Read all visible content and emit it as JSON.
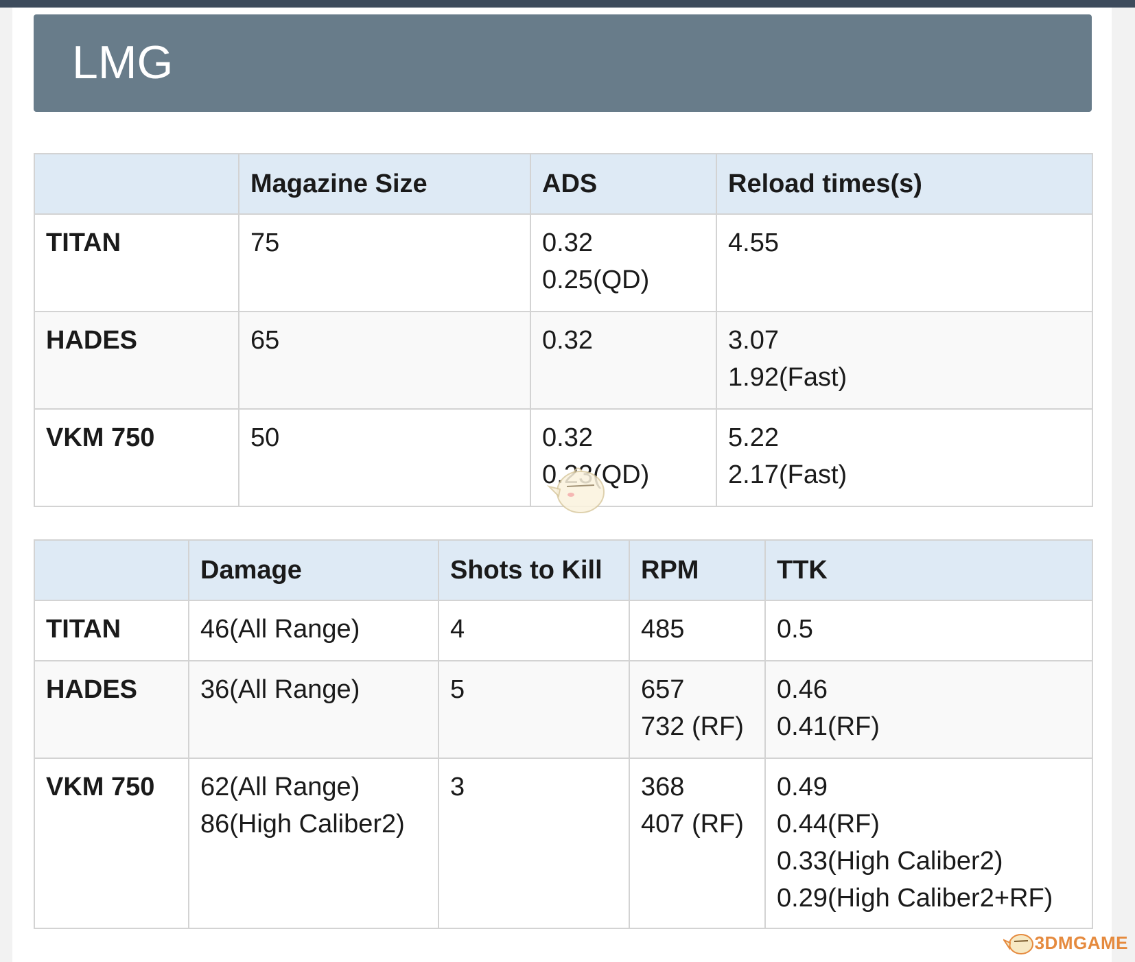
{
  "section_title": "LMG",
  "table_handling": {
    "headers": [
      "",
      "Magazine Size",
      "ADS",
      "Reload times(s)"
    ],
    "rows": [
      {
        "name": "TITAN",
        "magazine": [
          "75"
        ],
        "ads": [
          "0.32",
          "0.25(QD)"
        ],
        "reload": [
          "4.55"
        ]
      },
      {
        "name": "HADES",
        "magazine": [
          "65"
        ],
        "ads": [
          "0.32"
        ],
        "reload": [
          "3.07",
          "1.92(Fast)"
        ]
      },
      {
        "name": "VKM 750",
        "magazine": [
          "50"
        ],
        "ads": [
          "0.32",
          "0.23(QD)"
        ],
        "reload": [
          "5.22",
          "2.17(Fast)"
        ]
      }
    ]
  },
  "table_damage": {
    "headers": [
      "",
      "Damage",
      "Shots to Kill",
      "RPM",
      "TTK"
    ],
    "rows": [
      {
        "name": "TITAN",
        "damage": [
          "46(All Range)"
        ],
        "stk": [
          "4"
        ],
        "rpm": [
          "485"
        ],
        "ttk": [
          "0.5"
        ]
      },
      {
        "name": "HADES",
        "damage": [
          "36(All Range)"
        ],
        "stk": [
          "5"
        ],
        "rpm": [
          "657",
          "732 (RF)"
        ],
        "ttk": [
          "0.46",
          "0.41(RF)"
        ]
      },
      {
        "name": "VKM 750",
        "damage": [
          "62(All Range)",
          "86(High Caliber2)"
        ],
        "stk": [
          "3"
        ],
        "rpm": [
          "368",
          "407 (RF)"
        ],
        "ttk": [
          "0.49",
          "0.44(RF)",
          "0.33(High Caliber2)",
          "0.29(High Caliber2+RF)"
        ]
      }
    ]
  },
  "watermark": {
    "text": "3DMGAME",
    "icon": "mascot-bird-icon"
  },
  "colors": {
    "banner": "#687c8a",
    "header_row": "#deeaf5",
    "top_bar": "#3d4b5c",
    "watermark": "#e58a3e"
  }
}
